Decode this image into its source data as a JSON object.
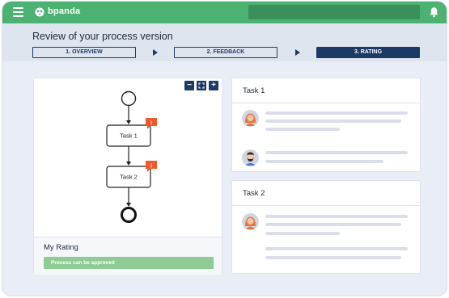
{
  "app": {
    "brand": "bpanda"
  },
  "header": {
    "title": "Review of your process version",
    "steps": [
      {
        "label": "1. OVERVIEW",
        "active": false
      },
      {
        "label": "2. FEEDBACK",
        "active": false
      },
      {
        "label": "3. RATING",
        "active": true
      }
    ]
  },
  "diagram": {
    "tasks": [
      "Task 1",
      "Task 2"
    ],
    "zoom_out": "−",
    "zoom_in": "+"
  },
  "rating": {
    "title": "My Rating",
    "status": "Process can be approved"
  },
  "task_panels": [
    {
      "title": "Task 1"
    },
    {
      "title": "Task 2"
    }
  ],
  "colors": {
    "brand_green": "#4cb272",
    "navy": "#1c3a66",
    "alert_orange": "#f05a2b",
    "approved_green": "#8ecb95"
  }
}
